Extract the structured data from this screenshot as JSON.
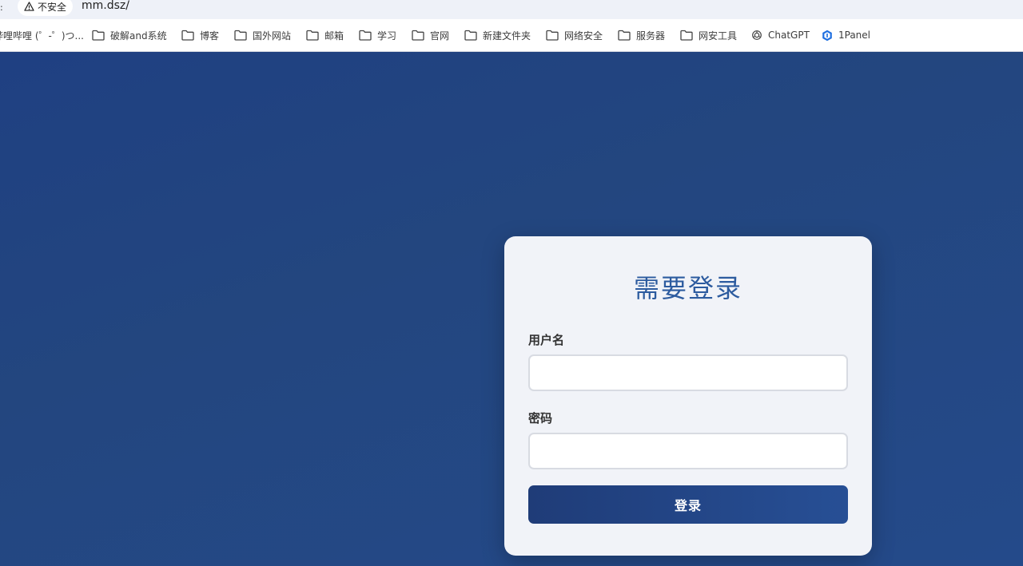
{
  "browser": {
    "security_label": "不安全",
    "url": "mm.dsz/"
  },
  "bookmarks": [
    {
      "label": "哔哩哔哩 (゜-゜)つ...",
      "icon": "bilibili-icon"
    },
    {
      "label": "破解and系统",
      "icon": "folder-icon"
    },
    {
      "label": "博客",
      "icon": "folder-icon"
    },
    {
      "label": "国外网站",
      "icon": "folder-icon"
    },
    {
      "label": "邮箱",
      "icon": "folder-icon"
    },
    {
      "label": "学习",
      "icon": "folder-icon"
    },
    {
      "label": "官网",
      "icon": "folder-icon"
    },
    {
      "label": "新建文件夹",
      "icon": "folder-icon"
    },
    {
      "label": "网络安全",
      "icon": "folder-icon"
    },
    {
      "label": "服务器",
      "icon": "folder-icon"
    },
    {
      "label": "网安工具",
      "icon": "folder-icon"
    },
    {
      "label": "ChatGPT",
      "icon": "openai-icon"
    },
    {
      "label": "1Panel",
      "icon": "1panel-icon"
    }
  ],
  "login": {
    "title": "需要登录",
    "username_label": "用户名",
    "username_value": "",
    "password_label": "密码",
    "password_value": "",
    "submit_label": "登录"
  },
  "colors": {
    "background": "#23467f",
    "card": "#f1f3f8",
    "title": "#2c5b9f",
    "button": "#23478a"
  }
}
